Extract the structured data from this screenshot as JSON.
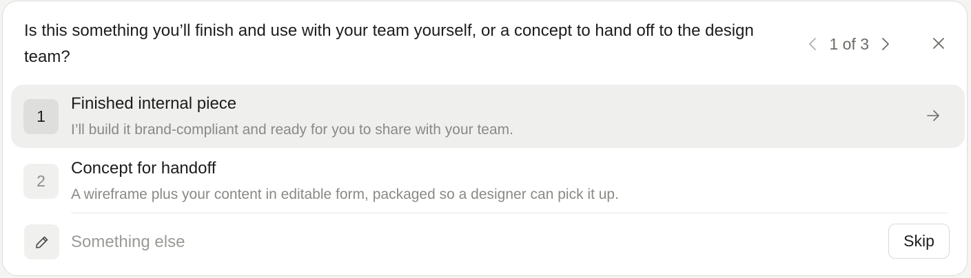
{
  "question": "Is this something you’ll finish and use with your team yourself, or a concept to hand off to the design team?",
  "pager": {
    "current": "1 of 3",
    "prev_icon": "chevron-left-icon",
    "next_icon": "chevron-right-icon"
  },
  "close_icon": "close-icon",
  "options": [
    {
      "number": "1",
      "title": "Finished internal piece",
      "description": "I’ll build it brand-compliant and ready for you to share with your team.",
      "selected": true,
      "icon": "arrow-right-icon"
    },
    {
      "number": "2",
      "title": "Concept for handoff",
      "description": "A wireframe plus your content in editable form, packaged so a designer can pick it up.",
      "selected": false
    }
  ],
  "other": {
    "icon": "pencil-icon",
    "placeholder": "Something else",
    "value": ""
  },
  "skip_label": "Skip",
  "colors": {
    "text": "#1c1c1a",
    "muted": "#8a8985",
    "selected_bg": "#efefee",
    "border": "#dcdcd9"
  }
}
